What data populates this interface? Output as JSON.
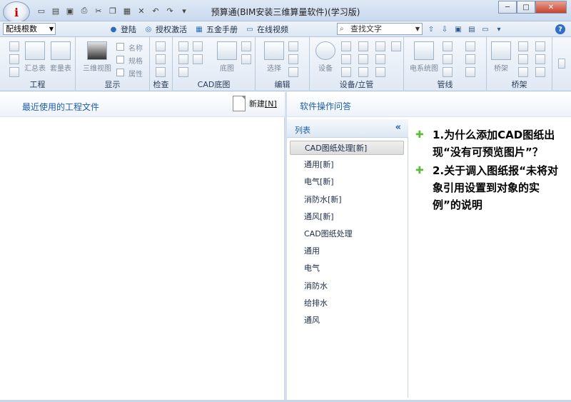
{
  "app": {
    "title": "预算通(BIM安装三维算量软件)(学习版)",
    "orb_letter": "i"
  },
  "quick_access": {
    "icons": [
      "new-file-icon",
      "open-icon",
      "save-icon",
      "print-icon",
      "cut-icon",
      "copy-icon",
      "paste-icon",
      "delete-icon",
      "undo-icon",
      "redo-icon",
      "customize-icon"
    ]
  },
  "window_controls": {
    "minimize": "─",
    "maximize": "□",
    "close": "✕"
  },
  "toolbar": {
    "profile_select": "配线根数",
    "links": [
      {
        "label": "登陆",
        "icon": "user-icon"
      },
      {
        "label": "授权激活",
        "icon": "key-icon"
      },
      {
        "label": "五金手册",
        "icon": "book-icon"
      },
      {
        "label": "在线视频",
        "icon": "video-icon"
      }
    ],
    "search_placeholder": "查找文字",
    "help": "?"
  },
  "ribbon": {
    "groups": [
      {
        "name": "工程",
        "buttons": [
          "汇总表",
          "套量表"
        ]
      },
      {
        "name": "显示",
        "buttons": [
          "三维视图"
        ],
        "checks": [
          "名称",
          "规格",
          "属性"
        ]
      },
      {
        "name": "检查"
      },
      {
        "name": "CAD底图",
        "buttons": [
          "底图"
        ]
      },
      {
        "name": "编辑",
        "buttons": [
          "选择"
        ]
      },
      {
        "name": "设备/立管",
        "buttons": [
          "设备"
        ]
      },
      {
        "name": "管线",
        "buttons": [
          "电系统图"
        ]
      },
      {
        "name": "桥架",
        "buttons": [
          "桥架"
        ]
      }
    ]
  },
  "left_pane": {
    "title": "最近使用的工程文件",
    "new_label": "新建",
    "new_shortcut": "[N]"
  },
  "right_pane": {
    "title": "软件操作问答",
    "list_title": "列表",
    "collapse": "«",
    "list_items": [
      "CAD图纸处理[新]",
      "通用[新]",
      "电气[新]",
      "消防水[新]",
      "通风[新]",
      "CAD图纸处理",
      "通用",
      "电气",
      "消防水",
      "给排水",
      "通风"
    ],
    "selected_index": 0,
    "faq": [
      "1.为什么添加CAD图纸出现“没有可预览图片”？",
      "2.关于调入图纸报“未将对象引用设置到对象的实例”的说明"
    ],
    "faq_bullet": "✚"
  },
  "colors": {
    "accent_blue": "#1d5ea8",
    "bullet_green": "#5dbb3b"
  }
}
